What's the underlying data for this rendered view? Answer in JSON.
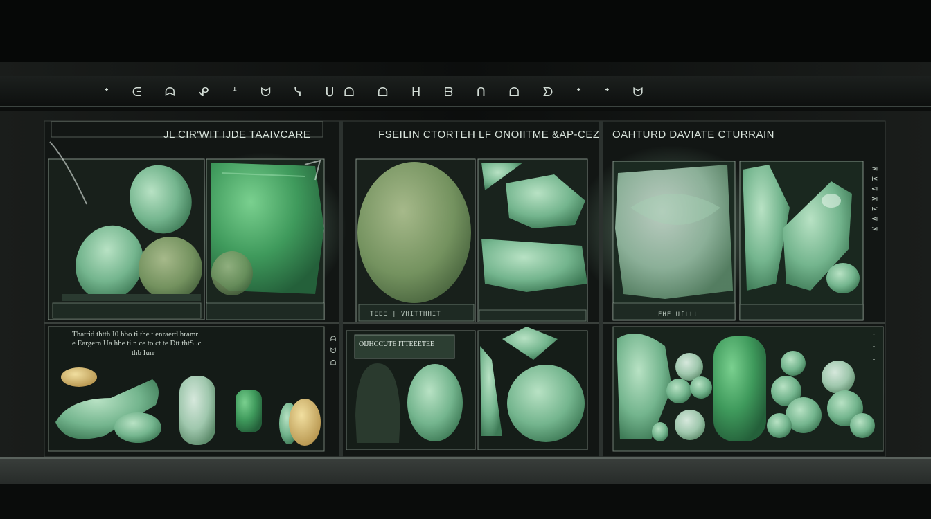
{
  "scene": {
    "description_colors": {
      "background": "#080a09",
      "jade_light": "#8fc7a3",
      "jade_mid": "#5fa57c",
      "jade_dark": "#3d7a55",
      "glass_edge": "#d2e6d7"
    }
  },
  "header": {
    "glyph_row": "ᐩ ᕮ ᗣ ᕵ ᗮ ᗢ ᓭ ᑌᗝ ᗝ ᕼ ᗷ ᑎ ᗝ ᗤ ᐩ ᐩ ᗢ"
  },
  "panels": [
    {
      "label": "JL CIR'WIT IJDE TAAIVCARE"
    },
    {
      "label": "FSEILIN CTORTEH LF ONOIITME &AP-CEZ"
    },
    {
      "label": "OAHTURD DAVIATE CTURRAIN"
    }
  ],
  "plaques": {
    "left_text_line1": "Thatrid thtth I0 hbo ti the t enraerd hramr",
    "left_text_line2": "e Eargern Ua hhe ti n ce to ct te Dtt thtS .c",
    "left_text_line3": "thb Iurr",
    "middle_label": "OIJHCCUTE ITTEEETEE",
    "tag_a": "TEEE | VHITTHHIT",
    "tag_b": "EHE Ufttt"
  },
  "side_text": {
    "right_top": "⊼ ⊻ ⊽ ⊼ ⊻ ⊽ ⊼",
    "right_bottom": "ᐩ ᐩ ᐩ",
    "left_mid": "ᗩ ᗢ ᗝ"
  }
}
